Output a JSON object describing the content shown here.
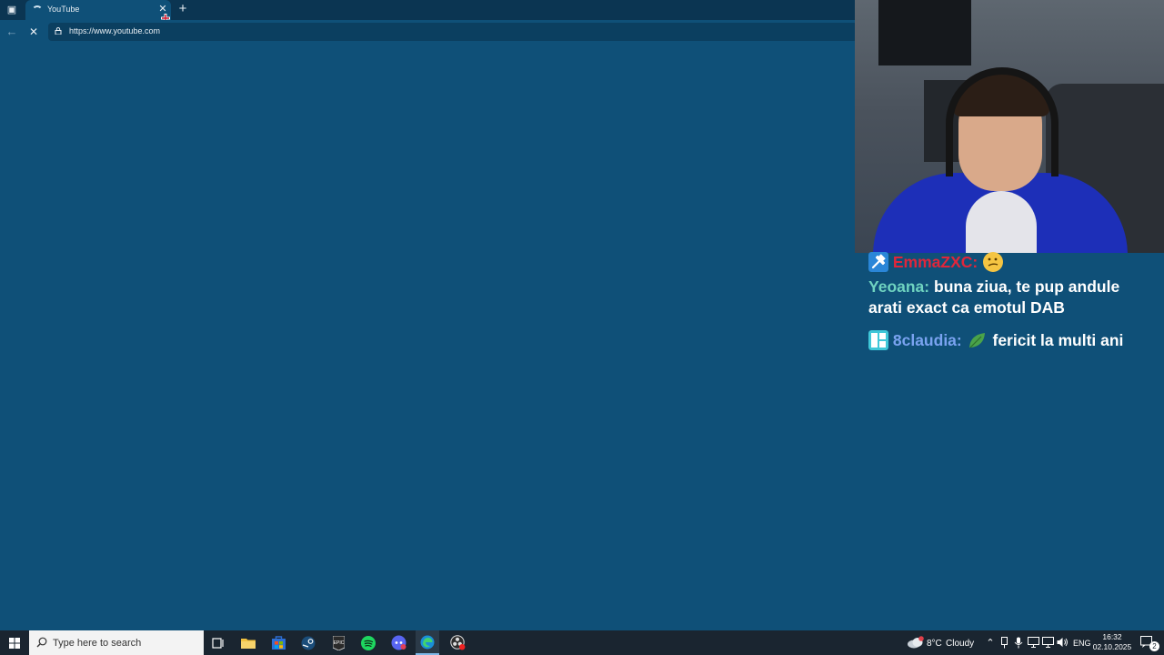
{
  "browser": {
    "tab_title": "YouTube",
    "url": "https://www.youtube.com"
  },
  "chat": {
    "messages": [
      {
        "user": "EmmaZXC:",
        "text": "",
        "user_color": "#e0263b",
        "emote": "thinking-face-emote"
      },
      {
        "user": "Yeoana:",
        "text": "buna ziua, te pup andule",
        "text2": "arati exact ca emotul DAB",
        "user_color": "#6fd3c0"
      },
      {
        "user": "8claudia:",
        "text": "fericit la multi ani",
        "user_color": "#7aa3f0",
        "emote": "leaf-emote"
      }
    ]
  },
  "taskbar": {
    "search_placeholder": "Type here to search",
    "weather_temp": "8°C",
    "weather_condition": "Cloudy",
    "language": "ENG",
    "time": "16:32",
    "date": "02.10.2025",
    "notification_count": "2"
  }
}
